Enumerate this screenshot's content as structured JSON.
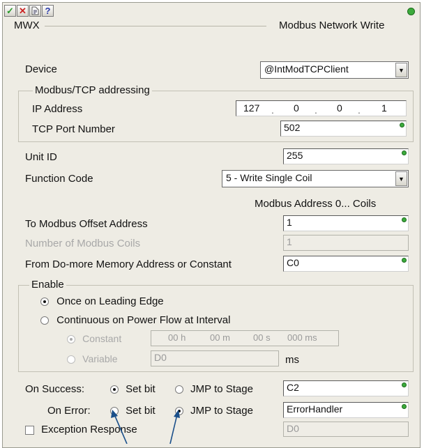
{
  "toolbar": {
    "ok_glyph": "✓",
    "cancel_glyph": "✕",
    "help_glyph": "?",
    "ok_color": "#2a9a2a",
    "cancel_color": "#cc2222",
    "help_color": "#2a3aaa",
    "status_light_color": "#3cab3c"
  },
  "header": {
    "instruction": "MWX",
    "description": "Modbus Network Write"
  },
  "device": {
    "label": "Device",
    "value": "@IntModTCPClient"
  },
  "tcp_group": {
    "legend": "Modbus/TCP addressing",
    "ip_label": "IP Address",
    "ip": [
      "127",
      "0",
      "0",
      "1"
    ],
    "port_label": "TCP Port Number",
    "port_value": "502"
  },
  "unit_id": {
    "label": "Unit ID",
    "value": "255"
  },
  "function_code": {
    "label": "Function Code",
    "value": "5 - Write Single Coil"
  },
  "modbus_range_note": "Modbus Address 0... Coils",
  "offset": {
    "label": "To Modbus Offset Address",
    "value": "1"
  },
  "num_coils": {
    "label": "Number of Modbus Coils",
    "value": "1"
  },
  "from_mem": {
    "label": "From Do-more Memory Address or Constant",
    "value": "C0"
  },
  "enable": {
    "legend": "Enable",
    "opt_leading": "Once on Leading Edge",
    "opt_continuous": "Continuous on Power Flow at Interval",
    "constant_label": "Constant",
    "variable_label": "Variable",
    "interval": {
      "h": "00 h",
      "m": "00 m",
      "s": "00 s",
      "ms": "000 ms"
    },
    "variable_value": "D0",
    "variable_unit": "ms"
  },
  "on_success": {
    "label": "On Success:",
    "set_bit": "Set bit",
    "jmp": "JMP to Stage",
    "value": "C2"
  },
  "on_error": {
    "label": "On Error:",
    "set_bit": "Set bit",
    "jmp": "JMP to Stage",
    "value": "ErrorHandler"
  },
  "exception": {
    "label": "Exception Response",
    "value": "D0"
  },
  "annotation_arrow_color": "#1a4f8a"
}
